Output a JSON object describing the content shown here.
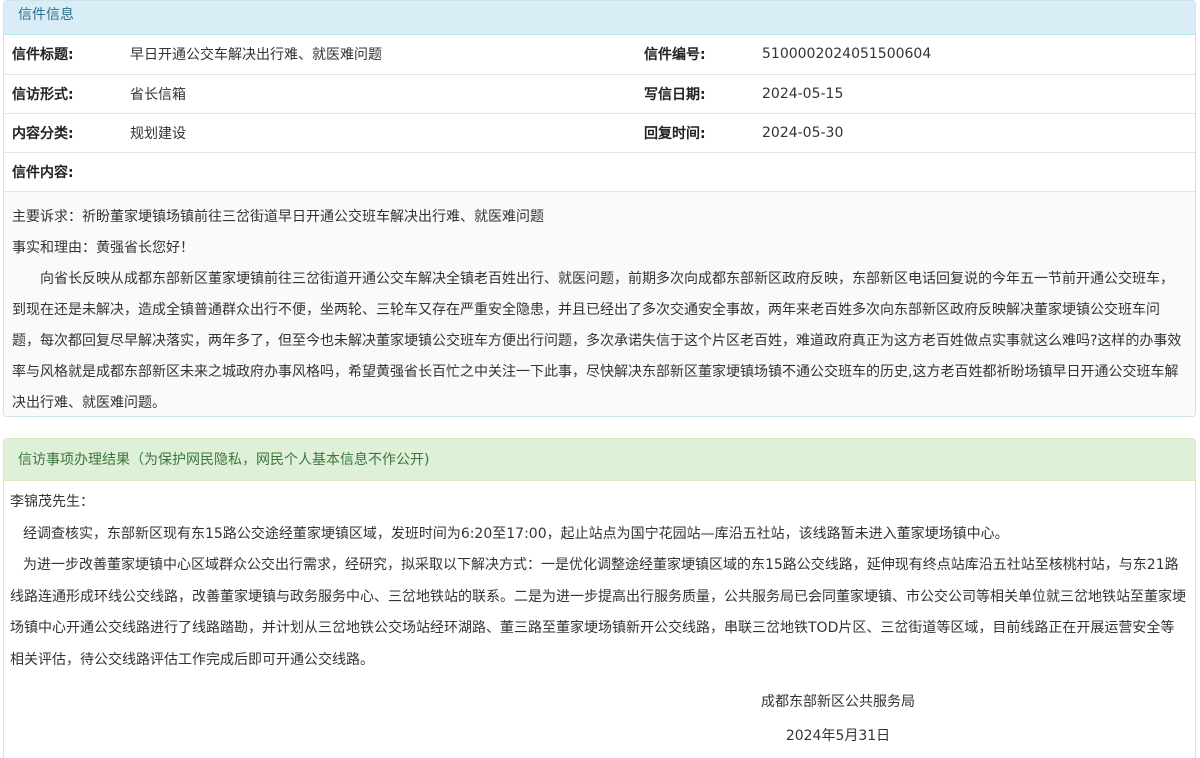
{
  "letter": {
    "heading": "信件信息",
    "rows": [
      {
        "label1": "信件标题:",
        "value1": "早日开通公交车解决出行难、就医难问题",
        "label2": "信件编号:",
        "value2": "5100002024051500604"
      },
      {
        "label1": "信访形式:",
        "value1": "省长信箱",
        "label2": "写信日期:",
        "value2": "2024-05-15"
      },
      {
        "label1": "内容分类:",
        "value1": "规划建设",
        "label2": "回复时间:",
        "value2": "2024-05-30"
      }
    ],
    "content_label": "信件内容:",
    "content": {
      "line1": "主要诉求：祈盼董家埂镇场镇前往三岔街道早日开通公交班车解决出行难、就医难问题",
      "line2": "事实和理由：黄强省长您好！",
      "body": "向省长反映从成都东部新区董家埂镇前往三岔街道开通公交车解决全镇老百姓出行、就医问题，前期多次向成都东部新区政府反映，东部新区电话回复说的今年五一节前开通公交班车，到现在还是未解决，造成全镇普通群众出行不便，坐两轮、三轮车又存在严重安全隐患，并且已经出了多次交通安全事故，两年来老百姓多次向东部新区政府反映解决董家埂镇公交班车问题，每次都回复尽早解决落实，两年多了，但至今也未解决董家埂镇公交班车方便出行问题，多次承诺失信于这个片区老百姓，难道政府真正为这方老百姓做点实事就这么难吗?这样的办事效率与风格就是成都东部新区未来之城政府办事风格吗，希望黄强省长百忙之中关注一下此事，尽快解决东部新区董家埂镇场镇不通公交班车的历史,这方老百姓都祈盼场镇早日开通公交班车解决出行难、就医难问题。"
    }
  },
  "result": {
    "heading": "信访事项办理结果（为保护网民隐私，网民个人基本信息不作公开)",
    "salutation": "李锦茂先生：",
    "para1": "经调查核实，东部新区现有东15路公交途经董家埂镇区域，发班时间为6:20至17:00，起止站点为国宁花园站—库沿五社站，该线路暂未进入董家埂场镇中心。",
    "para2": "为进一步改善董家埂镇中心区域群众公交出行需求，经研究，拟采取以下解决方式：一是优化调整途经董家埂镇区域的东15路公交线路，延伸现有终点站库沿五社站至核桃村站，与东21路线路连通形成环线公交线路，改善董家埂镇与政务服务中心、三岔地铁站的联系。二是为进一步提高出行服务质量，公共服务局已会同董家埂镇、市公交公司等相关单位就三岔地铁站至董家埂场镇中心开通公交线路进行了线路踏勘，并计划从三岔地铁公交场站经环湖路、董三路至董家埂场镇新开公交线路，串联三岔地铁TOD片区、三岔街道等区域，目前线路正在开展运营安全等相关评估，待公交线路评估工作完成后即可开通公交线路。",
    "signature_org": "成都东部新区公共服务局",
    "signature_date": "2024年5月31日"
  }
}
